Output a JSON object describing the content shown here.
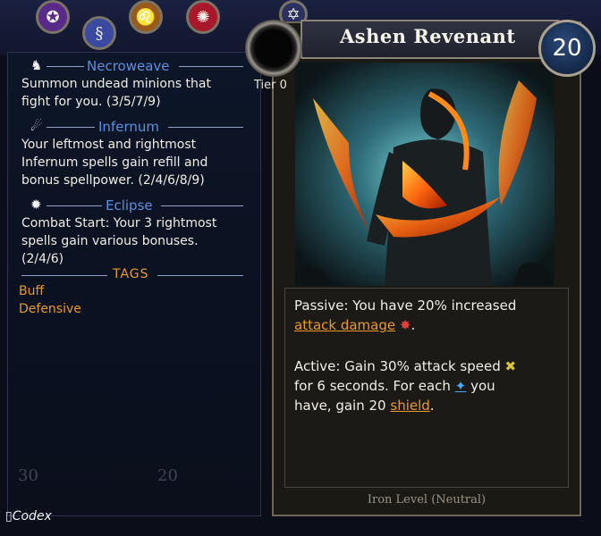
{
  "top_icons": [
    {
      "icon": "pentagram-icon",
      "glyph": "✪",
      "color": "#5a2a8a"
    },
    {
      "icon": "serpent-icon",
      "glyph": "§",
      "color": "#3a4aa0"
    },
    {
      "icon": "lion-icon",
      "glyph": "♌",
      "color": "#9a5a1a"
    },
    {
      "icon": "flame-swirl-icon",
      "glyph": "✺",
      "color": "#a8182a"
    },
    {
      "icon": "star-icon",
      "glyph": "✡",
      "color": "#2a3060"
    }
  ],
  "synergies": [
    {
      "name": "Necroweave",
      "icon": "wolf-icon",
      "glyph": "♞",
      "lines": [
        "Summon undead minions that",
        "fight for you. (3/5/7/9)"
      ]
    },
    {
      "name": "Infernum",
      "icon": "fire-swirl-icon",
      "glyph": "☄",
      "lines": [
        "Your leftmost and rightmost",
        "Infernum spells gain refill and",
        "bonus spellpower. (2/4/6/8/9)"
      ]
    },
    {
      "name": "Eclipse",
      "icon": "sun-icon",
      "glyph": "✹",
      "lines": [
        "Combat Start: Your 3 rightmost",
        "spells gain various bonuses.",
        "(2/4/6)"
      ]
    }
  ],
  "tags_header": "TAGS",
  "tags": [
    "Buff",
    "Defensive"
  ],
  "faded_stats": [
    "30",
    "20"
  ],
  "codex_label": "Codex",
  "card": {
    "title": "Ashen Revenant",
    "cost": "20",
    "tier_label": "Tier 0",
    "passive": {
      "line1": "Passive: You have 20% increased",
      "keyword": "attack damage",
      "end": "."
    },
    "active": {
      "line1": "Active: Gain 30% attack speed",
      "line2a": "for 6 seconds. For each",
      "line2b": "you",
      "line3a": "have, gain 20",
      "keyword": "shield",
      "end": "."
    },
    "footer": "Iron Level (Neutral)"
  },
  "colors": {
    "keyword": "#e89a2a",
    "synergy_name": "#5b8fe0",
    "tag": "#e89a2a"
  }
}
